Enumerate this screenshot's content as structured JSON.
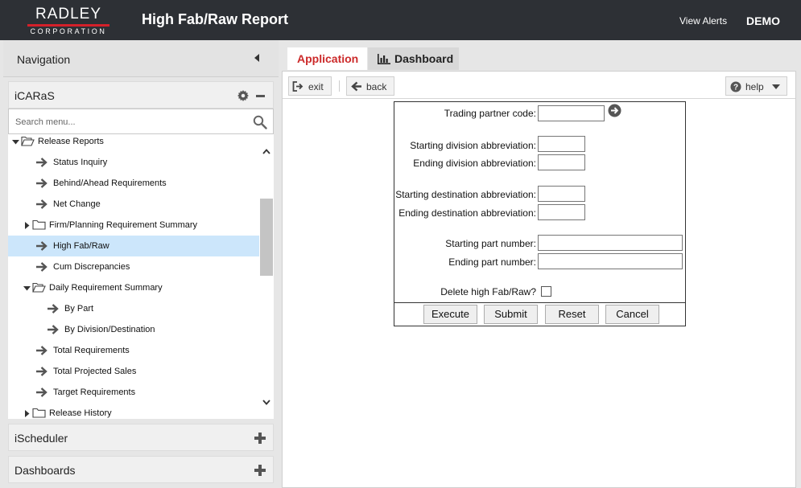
{
  "header": {
    "logo_top": "RADLEY",
    "logo_bottom": "CORPORATION",
    "title": "High Fab/Raw Report",
    "view_alerts": "View Alerts",
    "user": "DEMO"
  },
  "nav": {
    "title": "Navigation",
    "sections": {
      "icarus": "iCARaS",
      "ischeduler": "iScheduler",
      "dashboards": "Dashboards"
    },
    "search_placeholder": "Search menu...",
    "tree": [
      {
        "label": "Release Reports",
        "type": "folder-open",
        "depth": 0
      },
      {
        "label": "Status Inquiry",
        "type": "item",
        "depth": 1
      },
      {
        "label": "Behind/Ahead Requirements",
        "type": "item",
        "depth": 1
      },
      {
        "label": "Net Change",
        "type": "item",
        "depth": 1
      },
      {
        "label": "Firm/Planning Requirement Summary",
        "type": "folder",
        "depth": 1
      },
      {
        "label": "High Fab/Raw",
        "type": "item",
        "depth": 1,
        "selected": true
      },
      {
        "label": "Cum Discrepancies",
        "type": "item",
        "depth": 1
      },
      {
        "label": "Daily Requirement Summary",
        "type": "folder-open",
        "depth": 1
      },
      {
        "label": "By Part",
        "type": "item",
        "depth": 2
      },
      {
        "label": "By Division/Destination",
        "type": "item",
        "depth": 2
      },
      {
        "label": "Total Requirements",
        "type": "item",
        "depth": 1
      },
      {
        "label": "Total Projected Sales",
        "type": "item",
        "depth": 1
      },
      {
        "label": "Target Requirements",
        "type": "item",
        "depth": 1
      },
      {
        "label": "Release History",
        "type": "folder",
        "depth": 1
      }
    ]
  },
  "tabs": {
    "application": "Application",
    "dashboard": "Dashboard"
  },
  "toolbar": {
    "exit": "exit",
    "back": "back",
    "help": "help"
  },
  "form": {
    "trading_partner": {
      "label": "Trading partner code:",
      "value": ""
    },
    "start_division": {
      "label": "Starting division abbreviation:",
      "value": ""
    },
    "end_division": {
      "label": "Ending division abbreviation:",
      "value": ""
    },
    "start_destination": {
      "label": "Starting destination abbreviation:",
      "value": ""
    },
    "end_destination": {
      "label": "Ending destination abbreviation:",
      "value": ""
    },
    "start_part": {
      "label": "Starting part number:",
      "value": ""
    },
    "end_part": {
      "label": "Ending part number:",
      "value": ""
    },
    "delete_high": {
      "label": "Delete high Fab/Raw?"
    },
    "buttons": {
      "execute": "Execute",
      "submit": "Submit",
      "reset": "Reset",
      "cancel": "Cancel"
    }
  },
  "colors": {
    "header_bg": "#2d3035",
    "accent_red": "#cc2a2a",
    "selected_row": "#cce6fb"
  }
}
